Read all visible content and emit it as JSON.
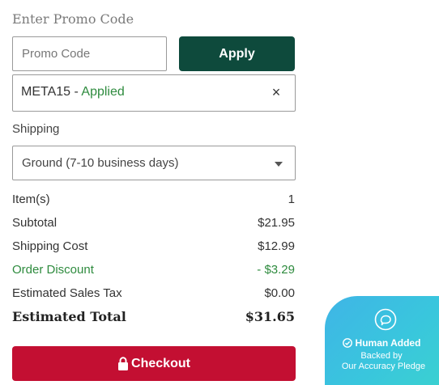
{
  "promo": {
    "heading": "Enter Promo Code",
    "placeholder": "Promo Code",
    "value": "",
    "apply_label": "Apply",
    "applied_code": "META15",
    "applied_separator": " - ",
    "applied_status": "Applied",
    "remove_glyph": "×"
  },
  "shipping": {
    "label": "Shipping",
    "selected": "Ground (7-10 business days)"
  },
  "summary": {
    "items_label": "Item(s)",
    "items_value": "1",
    "subtotal_label": "Subtotal",
    "subtotal_value": "$21.95",
    "shipping_label": "Shipping Cost",
    "shipping_value": "$12.99",
    "discount_label": "Order Discount",
    "discount_value": "- $3.29",
    "tax_label": "Estimated Sales Tax",
    "tax_value": "$0.00",
    "total_label": "Estimated Total",
    "total_value": "$31.65"
  },
  "checkout": {
    "label": "Checkout",
    "icon": "lock-icon"
  },
  "badge": {
    "title": "Human Added",
    "line1": "Backed by",
    "line2": "Our Accuracy Pledge",
    "icons": [
      "chat-bubble-icon",
      "check-circle-icon"
    ]
  },
  "colors": {
    "apply_bg": "#0e4a3c",
    "checkout_bg": "#c30f32",
    "success_green": "#2e8b3e",
    "badge_gradient_start": "#3fb5e6",
    "badge_gradient_end": "#3bd2cf"
  }
}
